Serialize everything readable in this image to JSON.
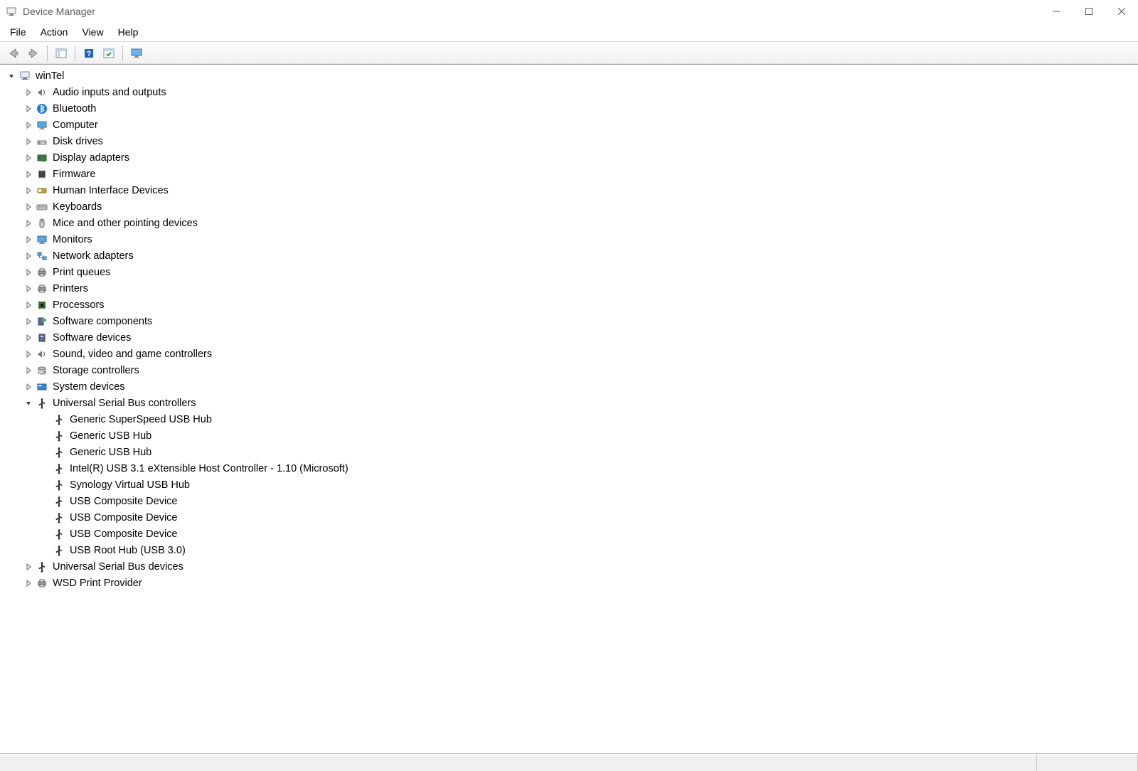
{
  "window": {
    "title": "Device Manager"
  },
  "menu": {
    "file": "File",
    "action": "Action",
    "view": "View",
    "help": "Help"
  },
  "toolbar": {
    "back": "back",
    "forward": "forward",
    "show_hide_console_tree": "show-hide-console-tree",
    "help": "help",
    "scan": "scan-for-hardware-changes",
    "update": "update-driver"
  },
  "tree": {
    "root": {
      "label": "winTel",
      "expanded": true,
      "icon": "computer-root"
    },
    "categories": [
      {
        "label": "Audio inputs and outputs",
        "icon": "speaker"
      },
      {
        "label": "Bluetooth",
        "icon": "bluetooth"
      },
      {
        "label": "Computer",
        "icon": "monitor"
      },
      {
        "label": "Disk drives",
        "icon": "disk"
      },
      {
        "label": "Display adapters",
        "icon": "display-card"
      },
      {
        "label": "Firmware",
        "icon": "chip"
      },
      {
        "label": "Human Interface Devices",
        "icon": "hid"
      },
      {
        "label": "Keyboards",
        "icon": "keyboard"
      },
      {
        "label": "Mice and other pointing devices",
        "icon": "mouse"
      },
      {
        "label": "Monitors",
        "icon": "monitor"
      },
      {
        "label": "Network adapters",
        "icon": "network"
      },
      {
        "label": "Print queues",
        "icon": "printer"
      },
      {
        "label": "Printers",
        "icon": "printer"
      },
      {
        "label": "Processors",
        "icon": "cpu"
      },
      {
        "label": "Software components",
        "icon": "software-component"
      },
      {
        "label": "Software devices",
        "icon": "software-device"
      },
      {
        "label": "Sound, video and game controllers",
        "icon": "speaker"
      },
      {
        "label": "Storage controllers",
        "icon": "storage"
      },
      {
        "label": "System devices",
        "icon": "system"
      },
      {
        "label": "Universal Serial Bus controllers",
        "icon": "usb",
        "expanded": true,
        "children": [
          {
            "label": "Generic SuperSpeed USB Hub"
          },
          {
            "label": "Generic USB Hub"
          },
          {
            "label": "Generic USB Hub"
          },
          {
            "label": "Intel(R) USB 3.1 eXtensible Host Controller - 1.10 (Microsoft)"
          },
          {
            "label": "Synology Virtual USB Hub"
          },
          {
            "label": "USB Composite Device"
          },
          {
            "label": "USB Composite Device"
          },
          {
            "label": "USB Composite Device"
          },
          {
            "label": "USB Root Hub (USB 3.0)"
          }
        ]
      },
      {
        "label": "Universal Serial Bus devices",
        "icon": "usb"
      },
      {
        "label": "WSD Print Provider",
        "icon": "printer"
      }
    ]
  }
}
